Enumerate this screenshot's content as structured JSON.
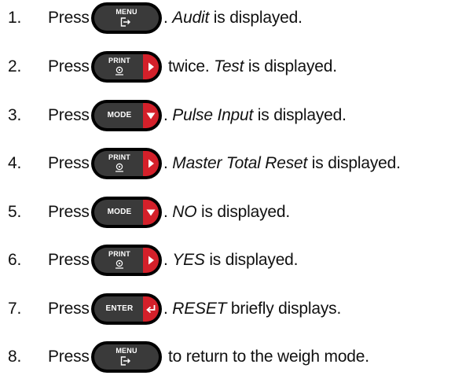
{
  "press_word": "Press",
  "key_labels": {
    "menu": "MENU",
    "print": "PRINT",
    "mode": "MODE",
    "enter": "ENTER"
  },
  "icons": {
    "menu": "exit-arrow-icon",
    "print": "print-target-icon",
    "print_accent": "right-arrow-icon",
    "mode_accent": "down-arrow-icon",
    "enter_accent": "enter-arrow-icon"
  },
  "colors": {
    "key_body": "#3a3a3a",
    "key_outline": "#000000",
    "key_accent": "#d4202a"
  },
  "steps": [
    {
      "number": "1.",
      "key": "menu",
      "text_pre": ". ",
      "text_em": "Audit",
      "text_post": " is displayed."
    },
    {
      "number": "2.",
      "key": "print",
      "text_pre": " twice. ",
      "text_em": "Test",
      "text_post": " is displayed."
    },
    {
      "number": "3.",
      "key": "mode",
      "text_pre": ". ",
      "text_em": "Pulse Input",
      "text_post": " is displayed."
    },
    {
      "number": "4.",
      "key": "print",
      "text_pre": ". ",
      "text_em": "Master Total Reset",
      "text_post": " is displayed."
    },
    {
      "number": "5.",
      "key": "mode",
      "text_pre": ". ",
      "text_em": "NO",
      "text_post": " is displayed."
    },
    {
      "number": "6.",
      "key": "print",
      "text_pre": ". ",
      "text_em": "YES",
      "text_post": " is displayed."
    },
    {
      "number": "7.",
      "key": "enter",
      "text_pre": ". ",
      "text_em": "RESET",
      "text_post": " briefly displays."
    },
    {
      "number": "8.",
      "key": "menu",
      "text_pre": " to return to the weigh mode.",
      "text_em": "",
      "text_post": ""
    }
  ]
}
